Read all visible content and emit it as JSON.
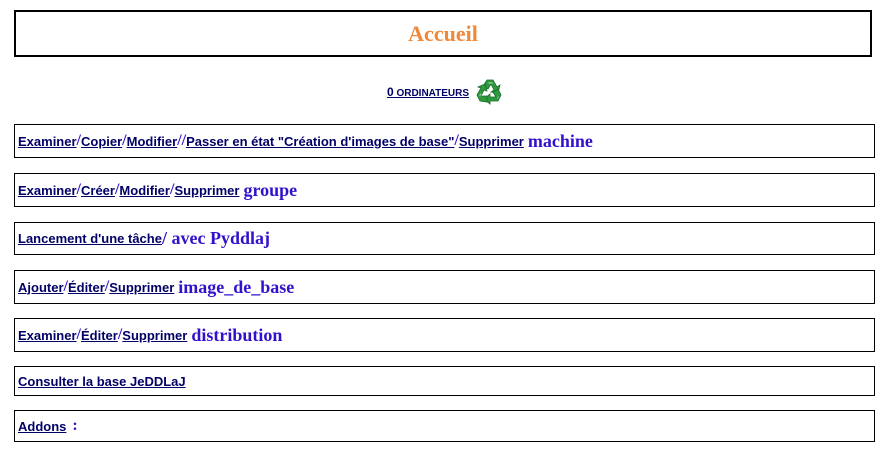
{
  "header": {
    "title": "Accueil"
  },
  "counter": {
    "count": "0",
    "label": "ORDINATEURS",
    "icon": "recycle-icon"
  },
  "rows": {
    "machine": {
      "links": [
        "Examiner",
        "Copier",
        "Modifier",
        "Passer en état \"Création d'images de base\"",
        "Supprimer"
      ],
      "entity": "machine"
    },
    "groupe": {
      "links": [
        "Examiner",
        "Créer",
        "Modifier",
        "Supprimer"
      ],
      "entity": "groupe"
    },
    "tache": {
      "link": "Lancement d'une tâche",
      "entity": "/ avec Pyddlaj"
    },
    "image": {
      "links": [
        "Ajouter",
        "Éditer",
        "Supprimer"
      ],
      "entity": "image_de_base"
    },
    "distribution": {
      "links": [
        "Examiner",
        "Éditer",
        "Supprimer"
      ],
      "entity": "distribution"
    },
    "jeddlaj": {
      "link": "Consulter la base JeDDLaJ"
    },
    "addons": {
      "link": "Addons",
      "suffix": ":"
    }
  },
  "colors": {
    "title": "#f0883a",
    "link": "#000066",
    "entity": "#3311cc",
    "recycle": "#2e9a3e"
  }
}
